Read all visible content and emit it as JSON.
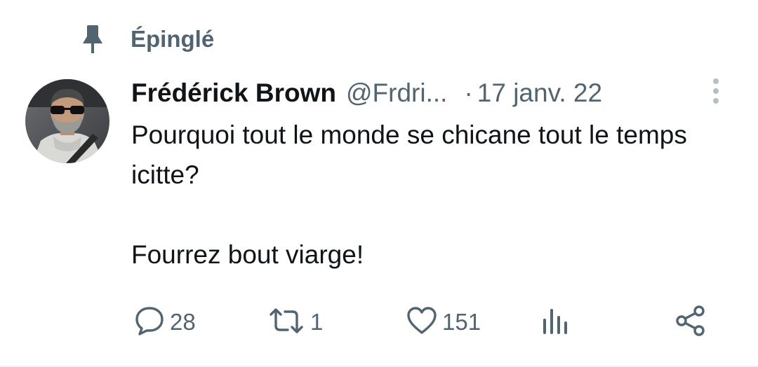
{
  "pinned": {
    "label": "Épinglé",
    "icon": "pin-icon"
  },
  "author": {
    "name": "Frédérick Brown",
    "handle": "@Frdri...",
    "separator": "·",
    "timestamp": "17 janv. 22",
    "avatar": "avatar-photo"
  },
  "tweet": {
    "paragraphs": [
      "Pourquoi tout le monde se chicane tout le temps icitte?",
      "Fourrez bout viarge!"
    ]
  },
  "actions": {
    "replies": {
      "icon": "reply-icon",
      "count": "28"
    },
    "retweets": {
      "icon": "retweet-icon",
      "count": "1"
    },
    "likes": {
      "icon": "heart-icon",
      "count": "151"
    },
    "views": {
      "icon": "analytics-icon",
      "count": ""
    },
    "share": {
      "icon": "share-icon"
    }
  },
  "colors": {
    "text_primary": "#0f1419",
    "text_secondary": "#536471",
    "divider": "#eff3f4"
  }
}
